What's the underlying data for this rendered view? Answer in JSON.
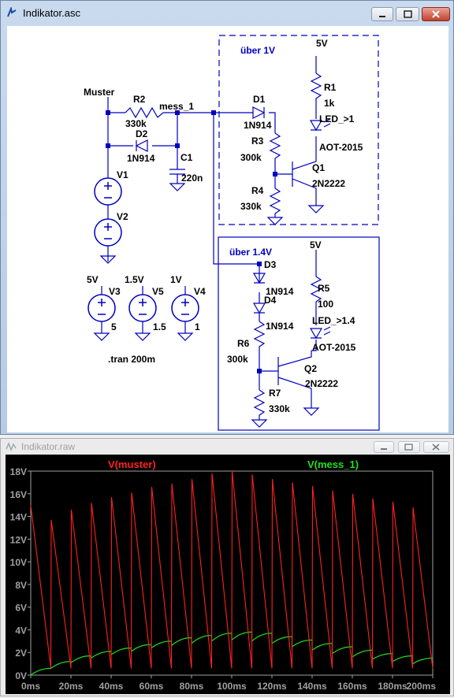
{
  "schematic_window": {
    "title": "Indikator.asc"
  },
  "schematic": {
    "net_labels": {
      "muster": "Muster",
      "mess": "mess_1"
    },
    "boxes": {
      "top": "über 1V",
      "bottom": "über 1.4V"
    },
    "components": {
      "R2": {
        "name": "R2",
        "value": "330k"
      },
      "D2": {
        "name": "D2",
        "value": "1N914"
      },
      "C1": {
        "name": "C1",
        "value": "220n"
      },
      "V1": {
        "name": "V1"
      },
      "V2": {
        "name": "V2"
      },
      "V3": {
        "name": "V3",
        "top": "5V",
        "value": "5"
      },
      "V5": {
        "name": "V5",
        "top": "1.5V",
        "value": "1.5"
      },
      "V4": {
        "name": "V4",
        "top": "1V",
        "value": "1"
      },
      "D1": {
        "name": "D1",
        "value": "1N914"
      },
      "R3": {
        "name": "R3",
        "value": "300k"
      },
      "R4": {
        "name": "R4",
        "value": "330k"
      },
      "R1": {
        "name": "R1",
        "value": "1k"
      },
      "LED1": {
        "name": "LED_>1",
        "value": "AOT-2015"
      },
      "Q1": {
        "name": "Q1",
        "value": "2N2222"
      },
      "VCC1": {
        "value": "5V"
      },
      "D3": {
        "name": "D3",
        "value": "1N914"
      },
      "D4": {
        "name": "D4",
        "value": "1N914"
      },
      "R6": {
        "name": "R6",
        "value": "300k"
      },
      "R7": {
        "name": "R7",
        "value": "330k"
      },
      "R5": {
        "name": "R5",
        "value": "100"
      },
      "LED2": {
        "name": "LED_>1.4",
        "value": "AOT-2015"
      },
      "Q2": {
        "name": "Q2",
        "value": "2N2222"
      },
      "VCC2": {
        "value": "5V"
      }
    },
    "directive": ".tran 200m"
  },
  "plot_window": {
    "title": "Indikator.raw"
  },
  "chart_data": {
    "type": "line",
    "xlabel": "",
    "ylabel": "",
    "xlim": [
      0,
      200
    ],
    "ylim": [
      0,
      18
    ],
    "x_unit": "ms",
    "y_unit": "V",
    "x_ticks": [
      "0ms",
      "20ms",
      "40ms",
      "60ms",
      "80ms",
      "100ms",
      "120ms",
      "140ms",
      "160ms",
      "180ms",
      "200ms"
    ],
    "y_ticks": [
      "0V",
      "2V",
      "4V",
      "6V",
      "8V",
      "10V",
      "12V",
      "14V",
      "16V",
      "18V"
    ],
    "series": [
      {
        "name": "V(muster)",
        "color": "#ff2020",
        "points": [
          [
            0,
            15.0
          ],
          [
            10,
            0.6
          ],
          [
            10.2,
            13.7
          ],
          [
            20,
            0.6
          ],
          [
            20.2,
            14.6
          ],
          [
            30,
            0.6
          ],
          [
            30.2,
            15.2
          ],
          [
            40,
            0.6
          ],
          [
            40.2,
            15.7
          ],
          [
            50,
            0.6
          ],
          [
            50.2,
            16.1
          ],
          [
            60,
            0.6
          ],
          [
            60.2,
            16.6
          ],
          [
            70,
            0.6
          ],
          [
            70.2,
            16.9
          ],
          [
            80,
            0.6
          ],
          [
            80.2,
            17.3
          ],
          [
            90,
            0.6
          ],
          [
            90.2,
            17.8
          ],
          [
            100,
            0.6
          ],
          [
            100.2,
            18.0
          ],
          [
            110,
            0.6
          ],
          [
            110.2,
            17.7
          ],
          [
            120,
            0.6
          ],
          [
            120.2,
            17.3
          ],
          [
            130,
            0.6
          ],
          [
            130.2,
            17.0
          ],
          [
            140,
            0.6
          ],
          [
            140.2,
            16.7
          ],
          [
            150,
            0.6
          ],
          [
            150.2,
            16.3
          ],
          [
            160,
            0.6
          ],
          [
            160.2,
            16.0
          ],
          [
            170,
            0.6
          ],
          [
            170.2,
            15.6
          ],
          [
            180,
            0.6
          ],
          [
            180.2,
            15.3
          ],
          [
            190,
            0.6
          ],
          [
            190.2,
            14.8
          ],
          [
            200,
            0.6
          ]
        ]
      },
      {
        "name": "V(mess_1)",
        "color": "#20e020",
        "peaks": [
          0.6,
          1.2,
          1.7,
          2.1,
          2.4,
          2.7,
          3.0,
          3.3,
          3.5,
          3.7,
          3.8,
          3.7,
          3.4,
          3.1,
          2.8,
          2.5,
          2.2,
          1.9,
          1.7,
          1.5
        ],
        "troughs": [
          0.0,
          0.6,
          1.1,
          1.5,
          1.8,
          2.1,
          2.4,
          2.6,
          2.8,
          3.0,
          3.1,
          3.0,
          2.8,
          2.5,
          2.2,
          1.9,
          1.6,
          1.4,
          1.2,
          1.0
        ]
      }
    ]
  }
}
